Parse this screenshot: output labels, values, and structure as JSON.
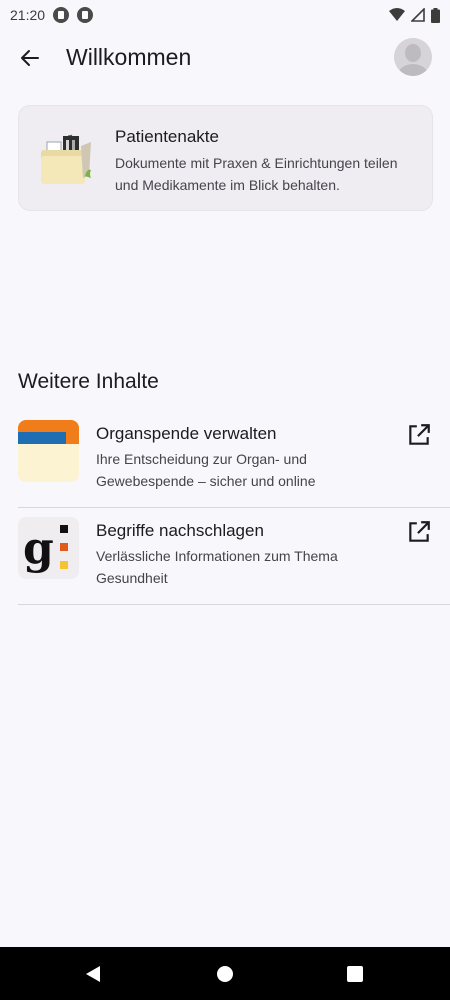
{
  "status_bar": {
    "time": "21:20"
  },
  "app_bar": {
    "title": "Willkommen"
  },
  "record_card": {
    "title": "Patientenakte",
    "description": "Dokumente mit Praxen & Einrichtungen teilen und Medikamente im Blick behalten."
  },
  "more_section": {
    "title": "Weitere Inhalte",
    "items": [
      {
        "title": "Organspende verwalten",
        "description": "Ihre Entscheidung zur Organ- und Gewebespende – sicher und online",
        "icon": "organ-donation-icon"
      },
      {
        "title": "Begriffe nachschlagen",
        "description": "Verlässliche Informationen zum Thema Gesundheit",
        "icon": "glossary-g-icon"
      }
    ]
  },
  "colors": {
    "background": "#f8f7fb",
    "card": "#efedf2",
    "organ_orange": "#f07d1a",
    "organ_blue": "#1f6db3",
    "organ_cream": "#fbf3d2"
  }
}
